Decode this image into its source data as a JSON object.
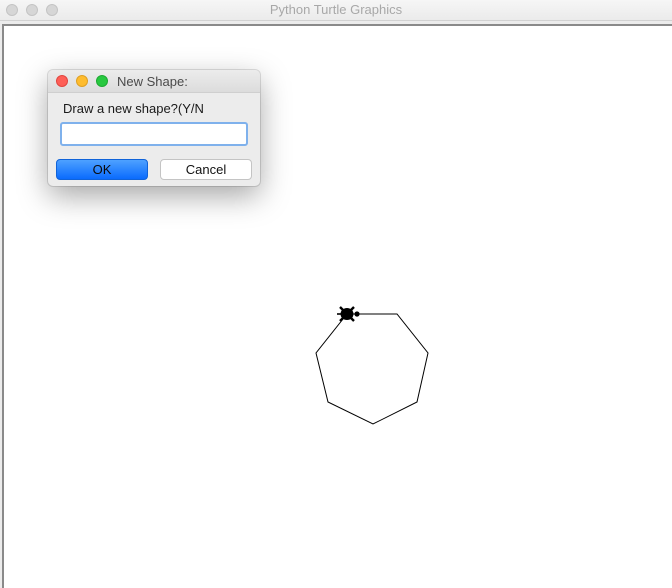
{
  "window": {
    "title": "Python Turtle Graphics"
  },
  "dialog": {
    "title": "New Shape:",
    "prompt": "Draw a new shape?(Y/N",
    "input_value": "",
    "ok_label": "OK",
    "cancel_label": "Cancel"
  },
  "drawing": {
    "shape": "heptagon",
    "turtle_icon": "turtle-icon",
    "stroke_color": "#000000"
  },
  "colors": {
    "ok_button": "#0a6bfd",
    "close_dot": "#fe5f57",
    "minimize_dot": "#febc2e",
    "maximize_dot": "#28c840"
  }
}
